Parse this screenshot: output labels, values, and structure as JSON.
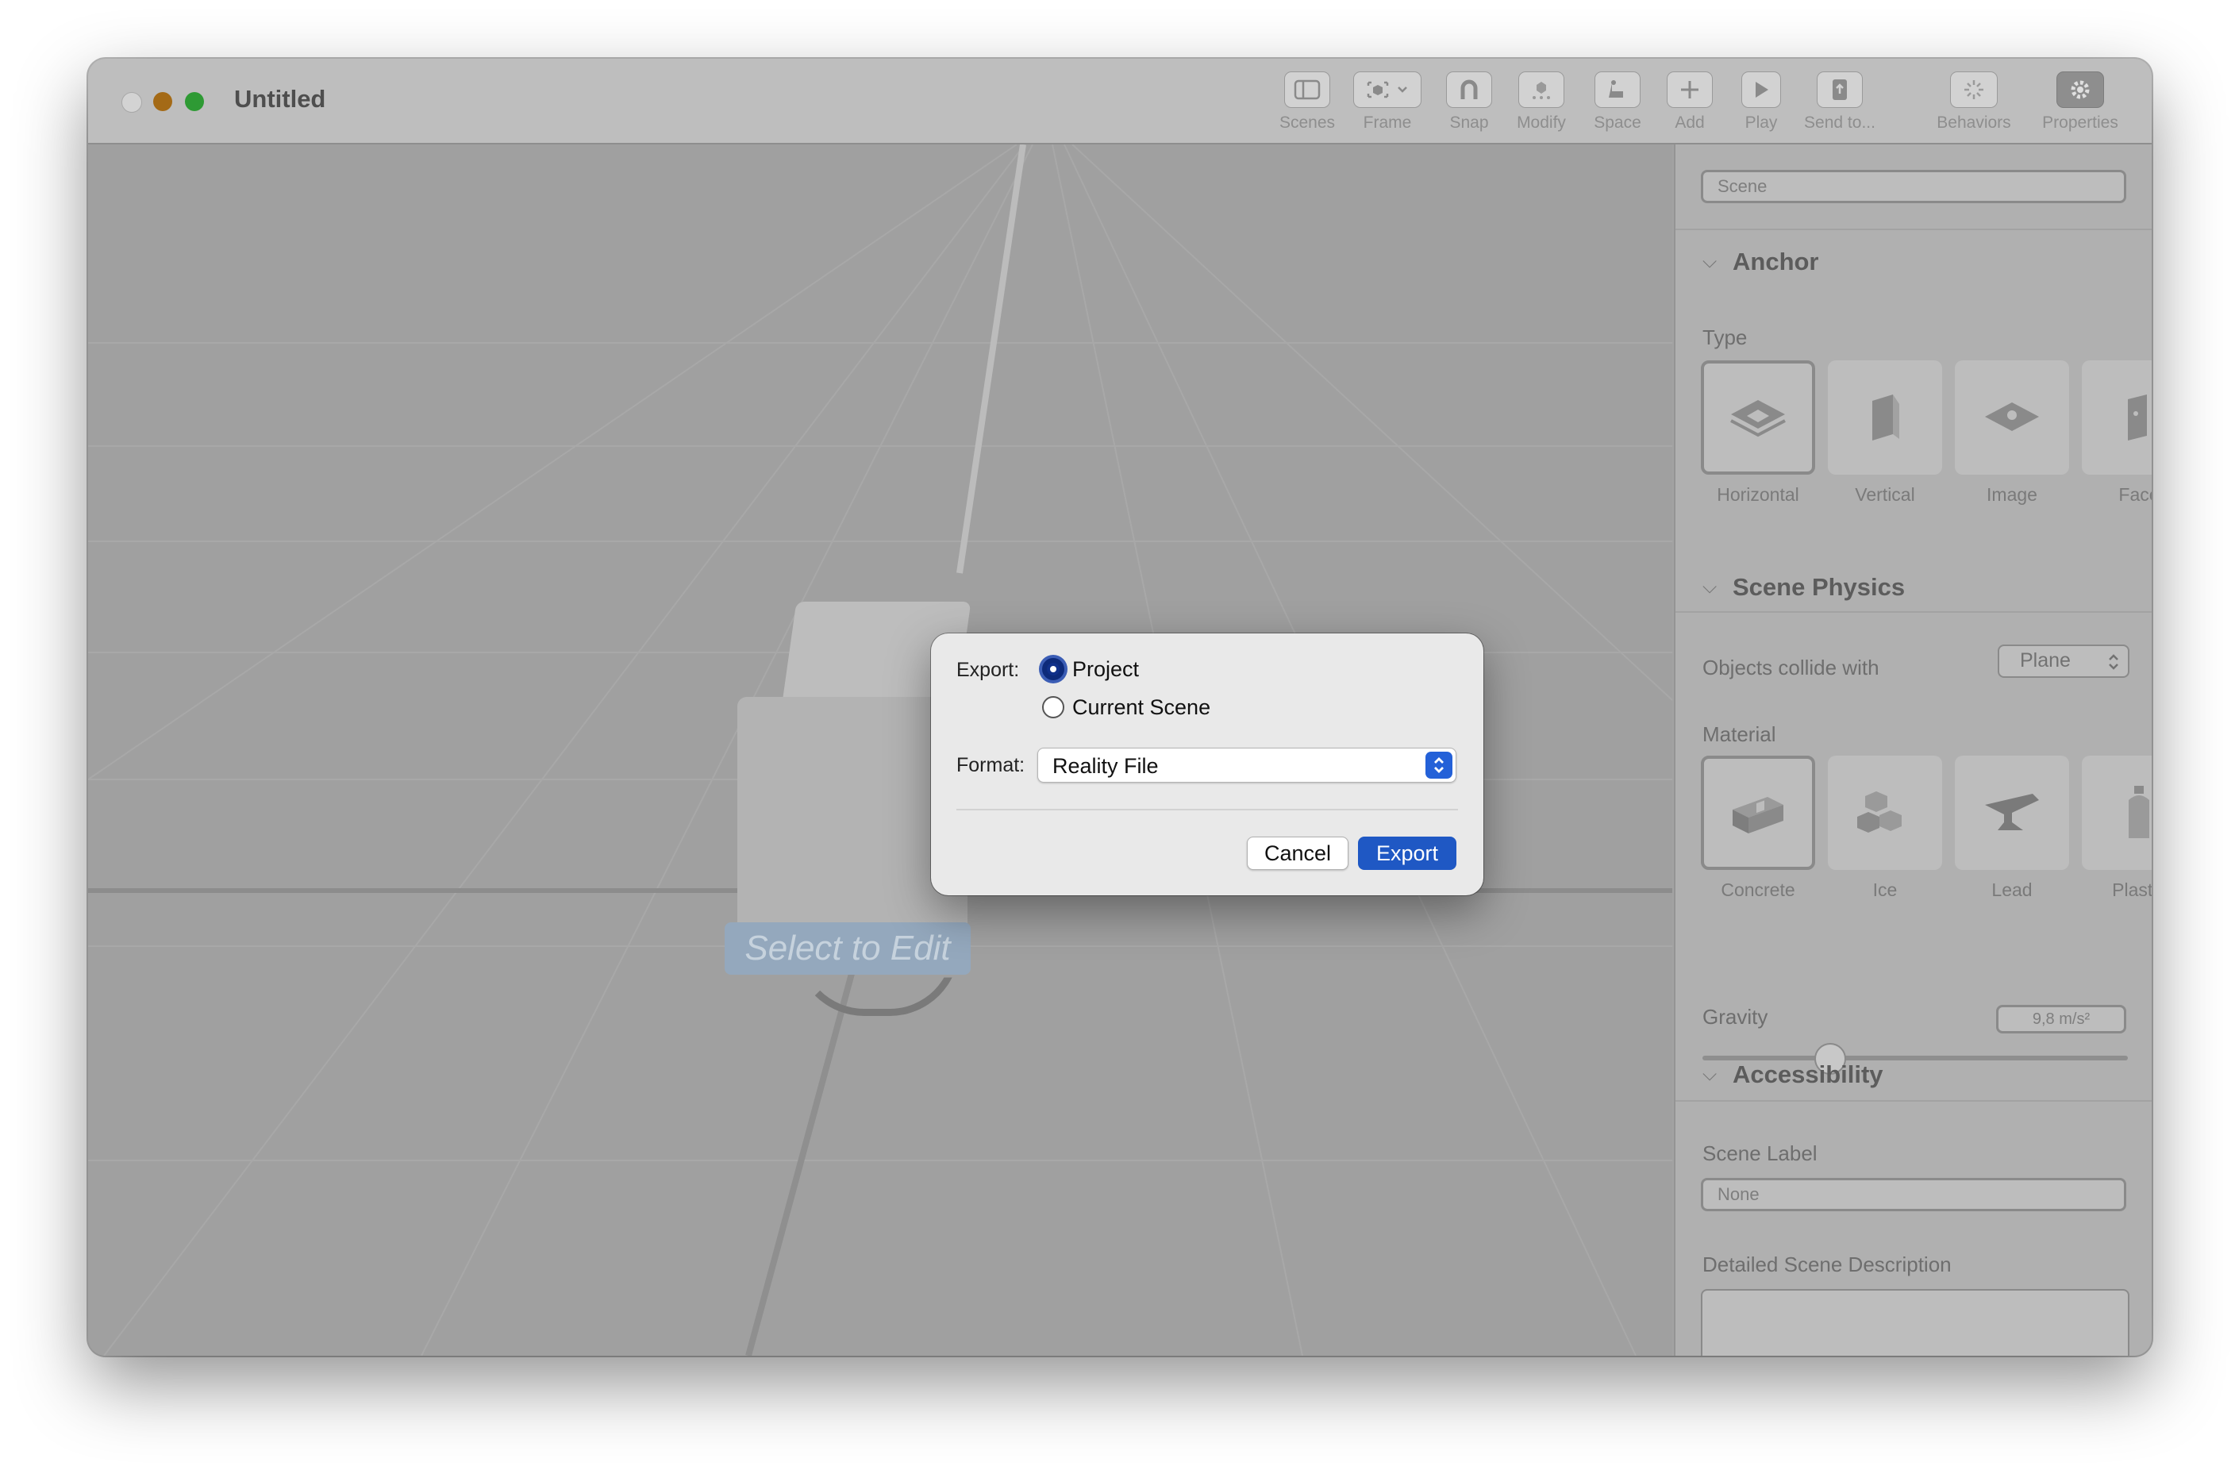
{
  "window": {
    "title": "Untitled"
  },
  "toolbar": {
    "scenes": "Scenes",
    "frame": "Frame",
    "snap": "Snap",
    "modify": "Modify",
    "space": "Space",
    "add": "Add",
    "play": "Play",
    "send_to": "Send to...",
    "behaviors": "Behaviors",
    "properties": "Properties"
  },
  "viewport": {
    "select_to_edit": "Select to Edit"
  },
  "sidebar": {
    "scene_name": "Scene",
    "anchor": {
      "header": "Anchor",
      "type_label": "Type",
      "types": [
        "Horizontal",
        "Vertical",
        "Image",
        "Face"
      ],
      "selected": "Horizontal"
    },
    "physics": {
      "header": "Scene Physics",
      "collide_label": "Objects collide with",
      "collide_value": "Plane",
      "material_label": "Material",
      "materials": [
        "Concrete",
        "Ice",
        "Lead",
        "Plastic"
      ],
      "selected_material": "Concrete",
      "gravity_label": "Gravity",
      "gravity_value": "9,8 m/s²",
      "gravity_slider_fraction": 0.3
    },
    "accessibility": {
      "header": "Accessibility",
      "scene_label": "Scene Label",
      "scene_label_placeholder": "None",
      "description_label": "Detailed Scene Description"
    }
  },
  "dialog": {
    "export_label": "Export:",
    "option_project": "Project",
    "option_current_scene": "Current Scene",
    "selected_option": "Project",
    "format_label": "Format:",
    "format_value": "Reality File",
    "cancel": "Cancel",
    "export": "Export"
  },
  "colors": {
    "accent": "#1f58c4",
    "radio_selected": "#10308a"
  }
}
